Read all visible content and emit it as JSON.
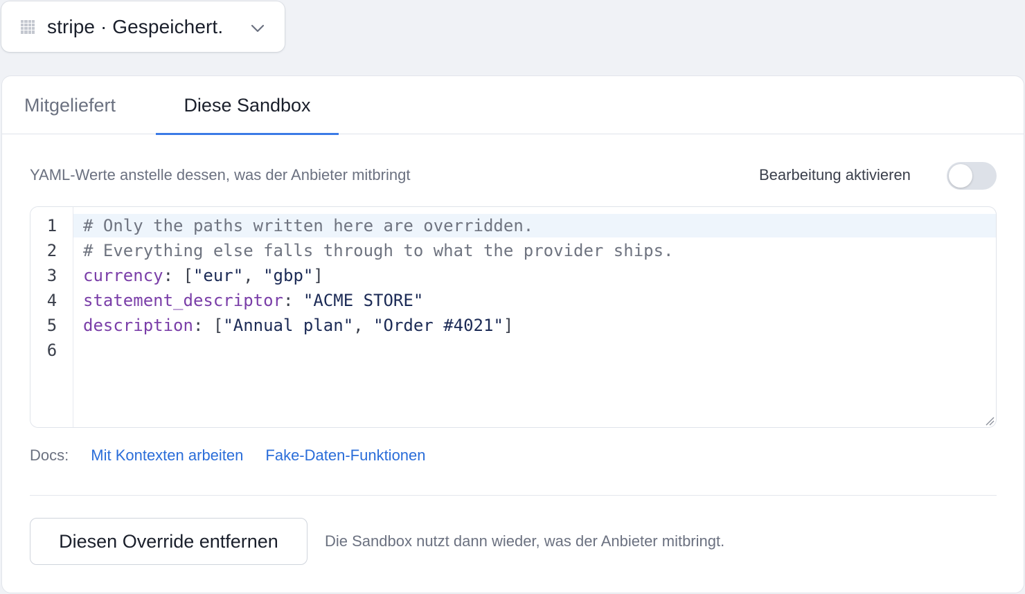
{
  "selector": {
    "label": "stripe · Gespeichert.",
    "icon": "grid-icon"
  },
  "tabs": [
    {
      "label": "Mitgeliefert",
      "active": false
    },
    {
      "label": "Diese Sandbox",
      "active": true
    }
  ],
  "override": {
    "description": "YAML-Werte anstelle dessen, was der Anbieter mitbringt",
    "toggle_label": "Bearbeitung aktivieren",
    "toggle_on": false
  },
  "editor": {
    "line_numbers": [
      "1",
      "2",
      "3",
      "4",
      "5",
      "6"
    ],
    "active_line": 1,
    "lines": [
      [
        {
          "t": "# Only the paths written here are overridden.",
          "c": "comment"
        }
      ],
      [
        {
          "t": "# Everything else falls through to what the provider ships.",
          "c": "comment"
        }
      ],
      [
        {
          "t": "currency",
          "c": "key"
        },
        {
          "t": ": [",
          "c": "punct"
        },
        {
          "t": "\"eur\"",
          "c": "str"
        },
        {
          "t": ", ",
          "c": "punct"
        },
        {
          "t": "\"gbp\"",
          "c": "str"
        },
        {
          "t": "]",
          "c": "punct"
        }
      ],
      [
        {
          "t": "statement_descriptor",
          "c": "key"
        },
        {
          "t": ": ",
          "c": "punct"
        },
        {
          "t": "\"ACME STORE\"",
          "c": "str"
        }
      ],
      [
        {
          "t": "description",
          "c": "key"
        },
        {
          "t": ": [",
          "c": "punct"
        },
        {
          "t": "\"Annual plan\"",
          "c": "str"
        },
        {
          "t": ", ",
          "c": "punct"
        },
        {
          "t": "\"Order #4021\"",
          "c": "str"
        },
        {
          "t": "]",
          "c": "punct"
        }
      ],
      []
    ]
  },
  "docs": {
    "label": "Docs:",
    "links": [
      "Mit Kontexten arbeiten",
      "Fake-Daten-Funktionen"
    ]
  },
  "footer": {
    "remove_button": "Diesen Override entfernen",
    "hint": "Die Sandbox nutzt dann wieder, was der Anbieter mitbringt."
  },
  "colors": {
    "accent": "#3b7be6",
    "link": "#2a6dd9",
    "yaml_key": "#7a3ea8",
    "yaml_string": "#1b2a55",
    "comment": "#6f7480"
  }
}
